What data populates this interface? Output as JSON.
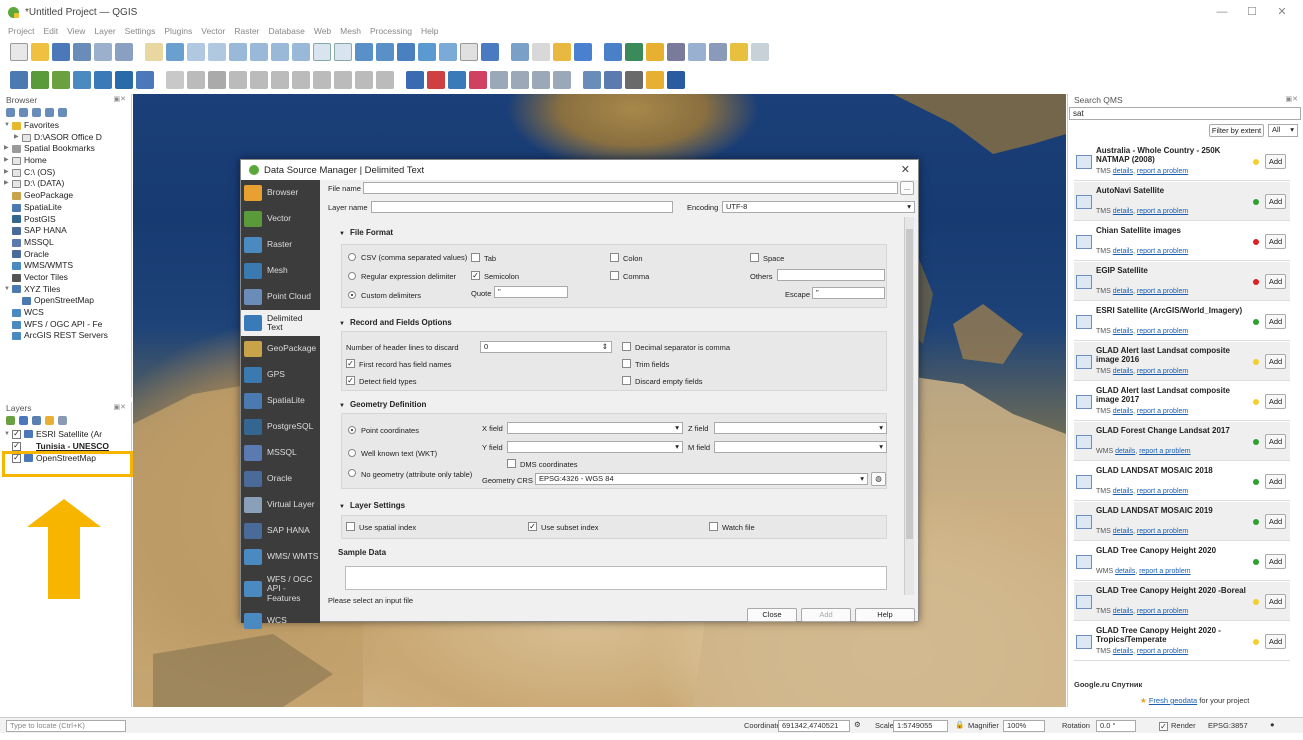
{
  "window": {
    "title": "*Untitled Project — QGIS",
    "min": "—",
    "max": "☐",
    "close": "✕"
  },
  "menu": [
    "Project",
    "Edit",
    "View",
    "Layer",
    "Settings",
    "Plugins",
    "Vector",
    "Raster",
    "Database",
    "Web",
    "Mesh",
    "Processing",
    "Help"
  ],
  "browser": {
    "title": "Browser",
    "items": [
      {
        "label": "Favorites",
        "arrow": "▼",
        "color": "#e8b82c"
      },
      {
        "label": "D:\\ASOR Office D",
        "arrow": "▶",
        "color": "#e6e6e6",
        "indent": 1
      },
      {
        "label": "Spatial Bookmarks",
        "arrow": "▶",
        "color": "#9a9a9a"
      },
      {
        "label": "Home",
        "arrow": "▶",
        "color": "#e6e6e6"
      },
      {
        "label": "C:\\ (OS)",
        "arrow": "▶",
        "color": "#e6e6e6"
      },
      {
        "label": "D:\\ (DATA)",
        "arrow": "▶",
        "color": "#e6e6e6"
      },
      {
        "label": "GeoPackage",
        "arrow": "",
        "color": "#c9a34a"
      },
      {
        "label": "SpatiaLite",
        "arrow": "",
        "color": "#4a7ab0"
      },
      {
        "label": "PostGIS",
        "arrow": "",
        "color": "#336791"
      },
      {
        "label": "SAP HANA",
        "arrow": "",
        "color": "#4a6a9a"
      },
      {
        "label": "MSSQL",
        "arrow": "",
        "color": "#5a7ab0"
      },
      {
        "label": "Oracle",
        "arrow": "",
        "color": "#4a6a9a"
      },
      {
        "label": "WMS/WMTS",
        "arrow": "",
        "color": "#4a8ac0"
      },
      {
        "label": "Vector Tiles",
        "arrow": "",
        "color": "#555"
      },
      {
        "label": "XYZ Tiles",
        "arrow": "▼",
        "color": "#4a7ab0"
      },
      {
        "label": "OpenStreetMap",
        "arrow": "",
        "color": "#4a7ab0",
        "indent": 1
      },
      {
        "label": "WCS",
        "arrow": "",
        "color": "#4a8ac0"
      },
      {
        "label": "WFS / OGC API - Fe",
        "arrow": "",
        "color": "#4a8ac0"
      },
      {
        "label": "ArcGIS REST Servers",
        "arrow": "",
        "color": "#4a8ac0"
      }
    ]
  },
  "layers": {
    "title": "Layers",
    "items": [
      {
        "label": "ESRI Satellite (Ar",
        "checked": "✓"
      },
      {
        "label": "Tunisia - UNESCO",
        "checked": "✓"
      },
      {
        "label": "OpenStreetMap",
        "checked": "✓"
      }
    ]
  },
  "qms": {
    "title": "Search QMS",
    "search_value": "sat",
    "filter_button": "Filter by extent",
    "filter_select": "All",
    "details": "details",
    "report": "report a problem",
    "add": "Add",
    "items": [
      {
        "title": "Australia - Whole Country - 250K NATMAP (2008)",
        "type": "TMS",
        "status": "#f2d030",
        "alt": false
      },
      {
        "title": "AutoNavi Satellite",
        "type": "TMS",
        "status": "#2ea02e",
        "alt": true
      },
      {
        "title": "Chian Satellite images",
        "type": "TMS",
        "status": "#e02020",
        "alt": false
      },
      {
        "title": "EGIP Satellite",
        "type": "TMS",
        "status": "#e02020",
        "alt": true
      },
      {
        "title": "ESRI Satellite (ArcGIS/World_Imagery)",
        "type": "TMS",
        "status": "#2ea02e",
        "alt": false
      },
      {
        "title": "GLAD Alert last Landsat composite image 2016",
        "type": "TMS",
        "status": "#f2d030",
        "alt": true
      },
      {
        "title": "GLAD Alert last Landsat composite image 2017",
        "type": "TMS",
        "status": "#f2d030",
        "alt": false
      },
      {
        "title": "GLAD Forest Change Landsat 2017",
        "type": "WMS",
        "status": "#2ea02e",
        "alt": true
      },
      {
        "title": "GLAD LANDSAT MOSAIC 2018",
        "type": "TMS",
        "status": "#2ea02e",
        "alt": false
      },
      {
        "title": "GLAD LANDSAT MOSAIC 2019",
        "type": "TMS",
        "status": "#2ea02e",
        "alt": true
      },
      {
        "title": "GLAD Tree Canopy Height 2020",
        "type": "WMS",
        "status": "#2ea02e",
        "alt": false
      },
      {
        "title": "GLAD Tree Canopy Height 2020 -Boreal",
        "type": "TMS",
        "status": "#f2d030",
        "alt": true
      },
      {
        "title": "GLAD Tree Canopy Height 2020 - Tropics/Temperate",
        "type": "TMS",
        "status": "#f2d030",
        "alt": false
      }
    ],
    "last_item": "Google.ru Спутник",
    "fresh_link": "Fresh geodata",
    "fresh_suffix": "for your project"
  },
  "dialog": {
    "title": "Data Source Manager | Delimited Text",
    "sidebar": [
      "Browser",
      "Vector",
      "Raster",
      "Mesh",
      "Point Cloud",
      "Delimited Text",
      "GeoPackage",
      "GPS",
      "SpatiaLite",
      "PostgreSQL",
      "MSSQL",
      "Oracle",
      "Virtual Layer",
      "SAP HANA",
      "WMS/ WMTS",
      "WFS / OGC API - Features",
      "WCS"
    ],
    "file_name_label": "File name",
    "browse_btn": "...",
    "layer_name_label": "Layer name",
    "encoding_label": "Encoding",
    "encoding_value": "UTF-8",
    "file_format": {
      "title": "File Format",
      "csv": "CSV (comma separated values)",
      "regex": "Regular expression delimiter",
      "custom": "Custom delimiters",
      "tab": "Tab",
      "colon": "Colon",
      "space": "Space",
      "semicolon": "Semicolon",
      "comma": "Comma",
      "others": "Others",
      "quote": "Quote",
      "quote_value": "\"",
      "escape": "Escape",
      "escape_value": "\""
    },
    "record": {
      "title": "Record and Fields Options",
      "header_lines": "Number of header lines to discard",
      "header_value": "0",
      "decimal": "Decimal separator is comma",
      "first_record": "First record has field names",
      "trim": "Trim fields",
      "detect": "Detect field types",
      "discard": "Discard empty fields"
    },
    "geometry": {
      "title": "Geometry Definition",
      "point": "Point coordinates",
      "wkt": "Well known text (WKT)",
      "none": "No geometry (attribute only table)",
      "xfield": "X field",
      "yfield": "Y field",
      "zfield": "Z field",
      "mfield": "M field",
      "dms": "DMS coordinates",
      "crs_label": "Geometry CRS",
      "crs_value": "EPSG:4326 - WGS 84"
    },
    "layer_settings": {
      "title": "Layer Settings",
      "spatial": "Use spatial index",
      "subset": "Use subset index",
      "watch": "Watch file"
    },
    "sample_title": "Sample Data",
    "status": "Please select an input file",
    "close": "Close",
    "add": "Add",
    "help": "Help"
  },
  "statusbar": {
    "locate": "Type to locate (Ctrl+K)",
    "coord_label": "Coordinate",
    "coord_value": "691342,4740521",
    "scale_label": "Scale",
    "scale_value": "1:5749055",
    "magnifier_label": "Magnifier",
    "magnifier_value": "100%",
    "rotation_label": "Rotation",
    "rotation_value": "0.0 °",
    "render_label": "Render",
    "crs": "EPSG:3857"
  }
}
